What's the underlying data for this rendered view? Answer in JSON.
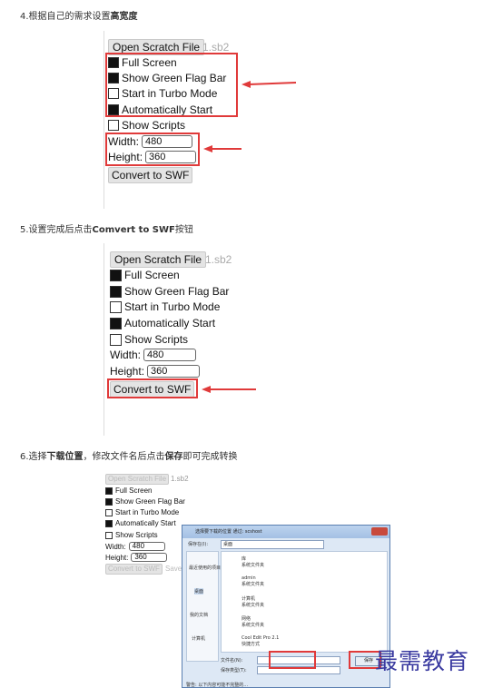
{
  "steps": [
    {
      "num": "4.",
      "pre": "根据自己的需求设置",
      "bold": "高宽度",
      "post": ""
    },
    {
      "num": "5.",
      "pre": "设置完成后点击",
      "bold": "Comvert to SWF",
      "post": "按钮"
    },
    {
      "num": "6.",
      "pre": "选择",
      "bold": "下载位置",
      "post": "，修改文件名后点击",
      "bold2": "保存",
      "post2": "即可完成转换"
    }
  ],
  "panel": {
    "open_label": "Open Scratch File",
    "filename": "1.sb2",
    "options": [
      {
        "label": "Full Screen",
        "checked": true
      },
      {
        "label": "Show Green Flag Bar",
        "checked": true
      },
      {
        "label": "Start in Turbo Mode",
        "checked": false
      },
      {
        "label": "Automatically Start",
        "checked": true
      },
      {
        "label": "Show Scripts",
        "checked": false
      }
    ],
    "width_label": "Width:",
    "width_value": "480",
    "height_label": "Height:",
    "height_value": "360",
    "convert_label": "Convert to SWF",
    "save_hint": "Save"
  },
  "dialog": {
    "title": "选择要下载的位置  通过: scshost",
    "location_label": "保存在(I):",
    "location_value": "桌面",
    "nav": [
      "最近使用的项目",
      "桌面",
      "我的文档",
      "计算机"
    ],
    "items": [
      {
        "name": "库",
        "sub": "系统文件夹"
      },
      {
        "name": "admin",
        "sub": "系统文件夹"
      },
      {
        "name": "计算机",
        "sub": "系统文件夹"
      },
      {
        "name": "网络",
        "sub": "系统文件夹"
      },
      {
        "name": "Cool Edit Pro 2.1",
        "sub": "快捷方式"
      }
    ],
    "filename_label": "文件名(N):",
    "filetype_label": "保存类型(T):",
    "save_button": "保存",
    "footer": "警告: 以下内容可能不完整的..."
  },
  "watermark": "最需教育",
  "colors": {
    "highlight": "#e03a3a",
    "checkbox_on": "#111111"
  }
}
